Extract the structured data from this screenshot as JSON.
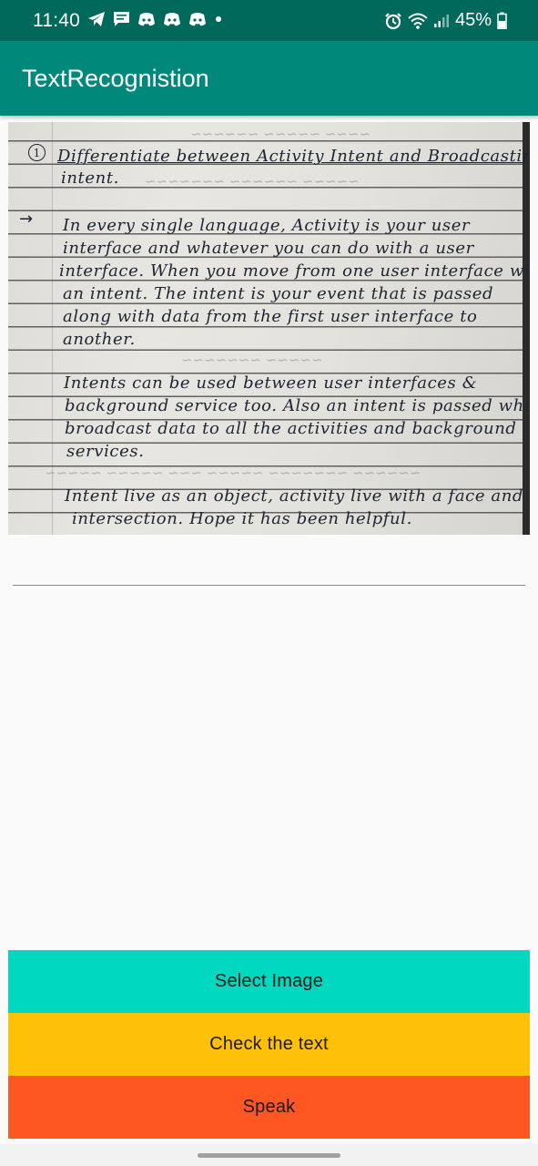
{
  "status_bar": {
    "time": "11:40",
    "left_icons": [
      "telegram-icon",
      "message-icon",
      "discord-icon",
      "discord-icon",
      "discord-icon",
      "dot-icon"
    ],
    "right_icons": [
      "alarm-icon",
      "wifi-icon",
      "signal-icon"
    ],
    "battery": "45%",
    "background": "#00695c"
  },
  "app_bar": {
    "title": "TextRecognistion",
    "background": "#00897b"
  },
  "photo": {
    "heading_number": "1",
    "heading_lines": [
      "Differentiate between Activity Intent and Broadcasting",
      "intent."
    ],
    "paragraph1": [
      "In every single language, Activity is your user",
      "interface and whatever you can do with a user",
      "interface. When you move from one user interface with",
      "an intent. The intent is your event that is passed",
      "along with data from the first user interface to",
      "another."
    ],
    "paragraph2": [
      "Intents can be used between user interfaces &",
      "background service too. Also an intent is passed when to",
      "broadcast data to all the activities and background",
      "services."
    ],
    "paragraph3": [
      "Intent live as an object, activity live with a face and",
      "intersection. Hope it has been helpful."
    ]
  },
  "buttons": {
    "select_image": "Select Image",
    "check_text": "Check the text",
    "speak": "Speak",
    "select_color": "#00d8c0",
    "check_color": "#ffc107",
    "speak_color": "#ff5722"
  }
}
